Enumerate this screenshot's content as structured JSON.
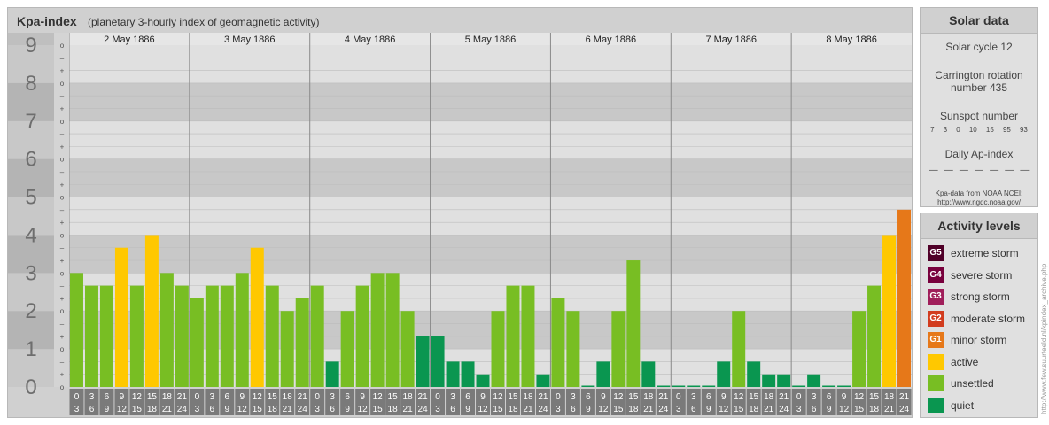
{
  "header": {
    "title": "Kpa-index",
    "subtitle": "(planetary 3-hourly index of geomagnetic activity)"
  },
  "chart_data": {
    "type": "bar",
    "ylim": [
      0,
      9
    ],
    "y_ticks": [
      "0",
      "1",
      "2",
      "3",
      "4",
      "5",
      "6",
      "7",
      "8",
      "9"
    ],
    "sub_ticks": [
      "o",
      "+",
      "–"
    ],
    "days": [
      "2 May 1886",
      "3 May 1886",
      "4 May 1886",
      "5 May 1886",
      "6 May 1886",
      "7 May 1886",
      "8 May 1886"
    ],
    "interval_labels": [
      [
        "0",
        "3"
      ],
      [
        "3",
        "6"
      ],
      [
        "6",
        "9"
      ],
      [
        "9",
        "12"
      ],
      [
        "12",
        "15"
      ],
      [
        "15",
        "18"
      ],
      [
        "18",
        "21"
      ],
      [
        "21",
        "24"
      ]
    ],
    "values": [
      3.0,
      2.667,
      2.667,
      3.667,
      2.667,
      4.0,
      3.0,
      2.667,
      2.333,
      2.667,
      2.667,
      3.0,
      3.667,
      2.667,
      2.0,
      2.333,
      2.667,
      0.667,
      2.0,
      2.667,
      3.0,
      3.0,
      2.0,
      1.333,
      1.333,
      0.667,
      0.667,
      0.333,
      2.0,
      2.667,
      2.667,
      0.333,
      2.333,
      2.0,
      0.0,
      0.667,
      2.0,
      3.333,
      0.667,
      0.0,
      0.0,
      0.0,
      0.0,
      0.667,
      2.0,
      0.667,
      0.333,
      0.333,
      0.0,
      0.333,
      0.0,
      0.0,
      2.0,
      2.667,
      4.0,
      4.667
    ],
    "grid": true,
    "level_colors": {
      "quiet": "#0a9650",
      "unsettled": "#78be23",
      "active": "#ffc800",
      "minor": "#e67819"
    }
  },
  "solar": {
    "title": "Solar data",
    "cycle": "Solar cycle 12",
    "carrington_line1": "Carrington rotation",
    "carrington_line2": "number 435",
    "sunspot_label": "Sunspot number",
    "sunspot_values": [
      "7",
      "3",
      "0",
      "10",
      "15",
      "95",
      "93"
    ],
    "ap_label": "Daily Ap-index",
    "ap_values": [
      "—",
      "—",
      "—",
      "—",
      "—",
      "—",
      "—"
    ],
    "source_line1": "Kpa-data from NOAA NCEI:",
    "source_line2": "http://www.ngdc.noaa.gov/"
  },
  "levels": {
    "title": "Activity levels",
    "items": [
      {
        "badge": "G5",
        "label": "extreme storm",
        "color": "#500028"
      },
      {
        "badge": "G4",
        "label": "severe storm",
        "color": "#78003c"
      },
      {
        "badge": "G3",
        "label": "strong storm",
        "color": "#a01e5a"
      },
      {
        "badge": "G2",
        "label": "moderate storm",
        "color": "#d23c1e"
      },
      {
        "badge": "G1",
        "label": "minor storm",
        "color": "#e67819"
      },
      {
        "badge": "",
        "label": "active",
        "color": "#ffc800"
      },
      {
        "badge": "",
        "label": "unsettled",
        "color": "#78be23"
      },
      {
        "badge": "",
        "label": "quiet",
        "color": "#0a9650"
      }
    ]
  },
  "credit": "http://www.few.suurteeld.nl/kpindex_archive.php"
}
